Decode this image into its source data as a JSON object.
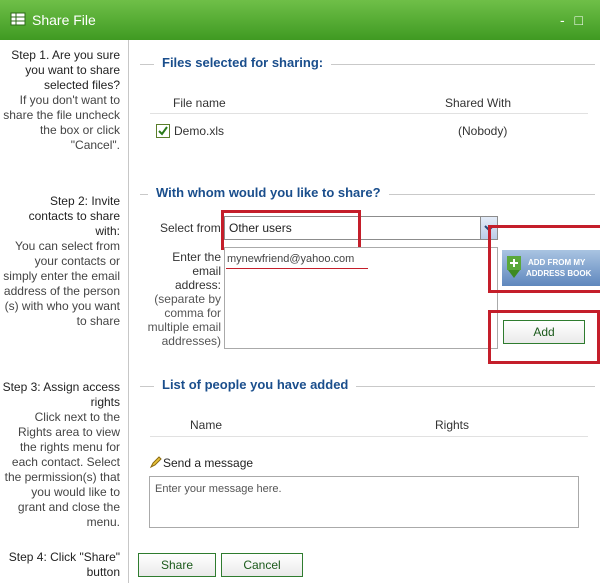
{
  "window": {
    "title": "Share File",
    "controls": "- □"
  },
  "steps": {
    "step1": {
      "head": "Step 1. Are you sure you want to share selected files?",
      "body": "If you don't want to share the file uncheck the box or click \"Cancel\"."
    },
    "step2": {
      "head": "Step 2: Invite contacts to share with:",
      "body": "You can select from your contacts or simply enter the email address of the person (s) with who you want to share"
    },
    "step3": {
      "head": "Step 3: Assign access rights",
      "body": "Click next to the Rights area to view the rights menu for each contact. Select the permission(s) that you would like to grant and close the menu."
    },
    "step4": {
      "head": "Step 4: Click \"Share\" button"
    }
  },
  "files_section": {
    "legend": "Files selected for sharing:",
    "columns": [
      "File name",
      "Shared With"
    ],
    "rows": [
      {
        "checked": true,
        "name": "Demo.xls",
        "shared_with": "(Nobody)"
      }
    ]
  },
  "share_section": {
    "legend": "With whom would you like to share?",
    "select_label": "Select from:",
    "select_value": "Other users",
    "email_label_1": "Enter the email address:",
    "email_hint": "(separate by comma for multiple email addresses)",
    "email_value": "mynewfriend@yahoo.com",
    "address_book_line1": "ADD FROM MY",
    "address_book_line2": "ADDRESS BOOK",
    "add_label": "Add"
  },
  "people_section": {
    "legend": "List of people you have added",
    "columns": [
      "Name",
      "Rights"
    ],
    "send_message_label": "Send a message",
    "message_placeholder": "Enter your message here."
  },
  "buttons": {
    "share": "Share",
    "cancel": "Cancel"
  },
  "colors": {
    "title_bar": "#3f9a22",
    "legend": "#1a4e8c",
    "highlight": "#c41e2a"
  }
}
